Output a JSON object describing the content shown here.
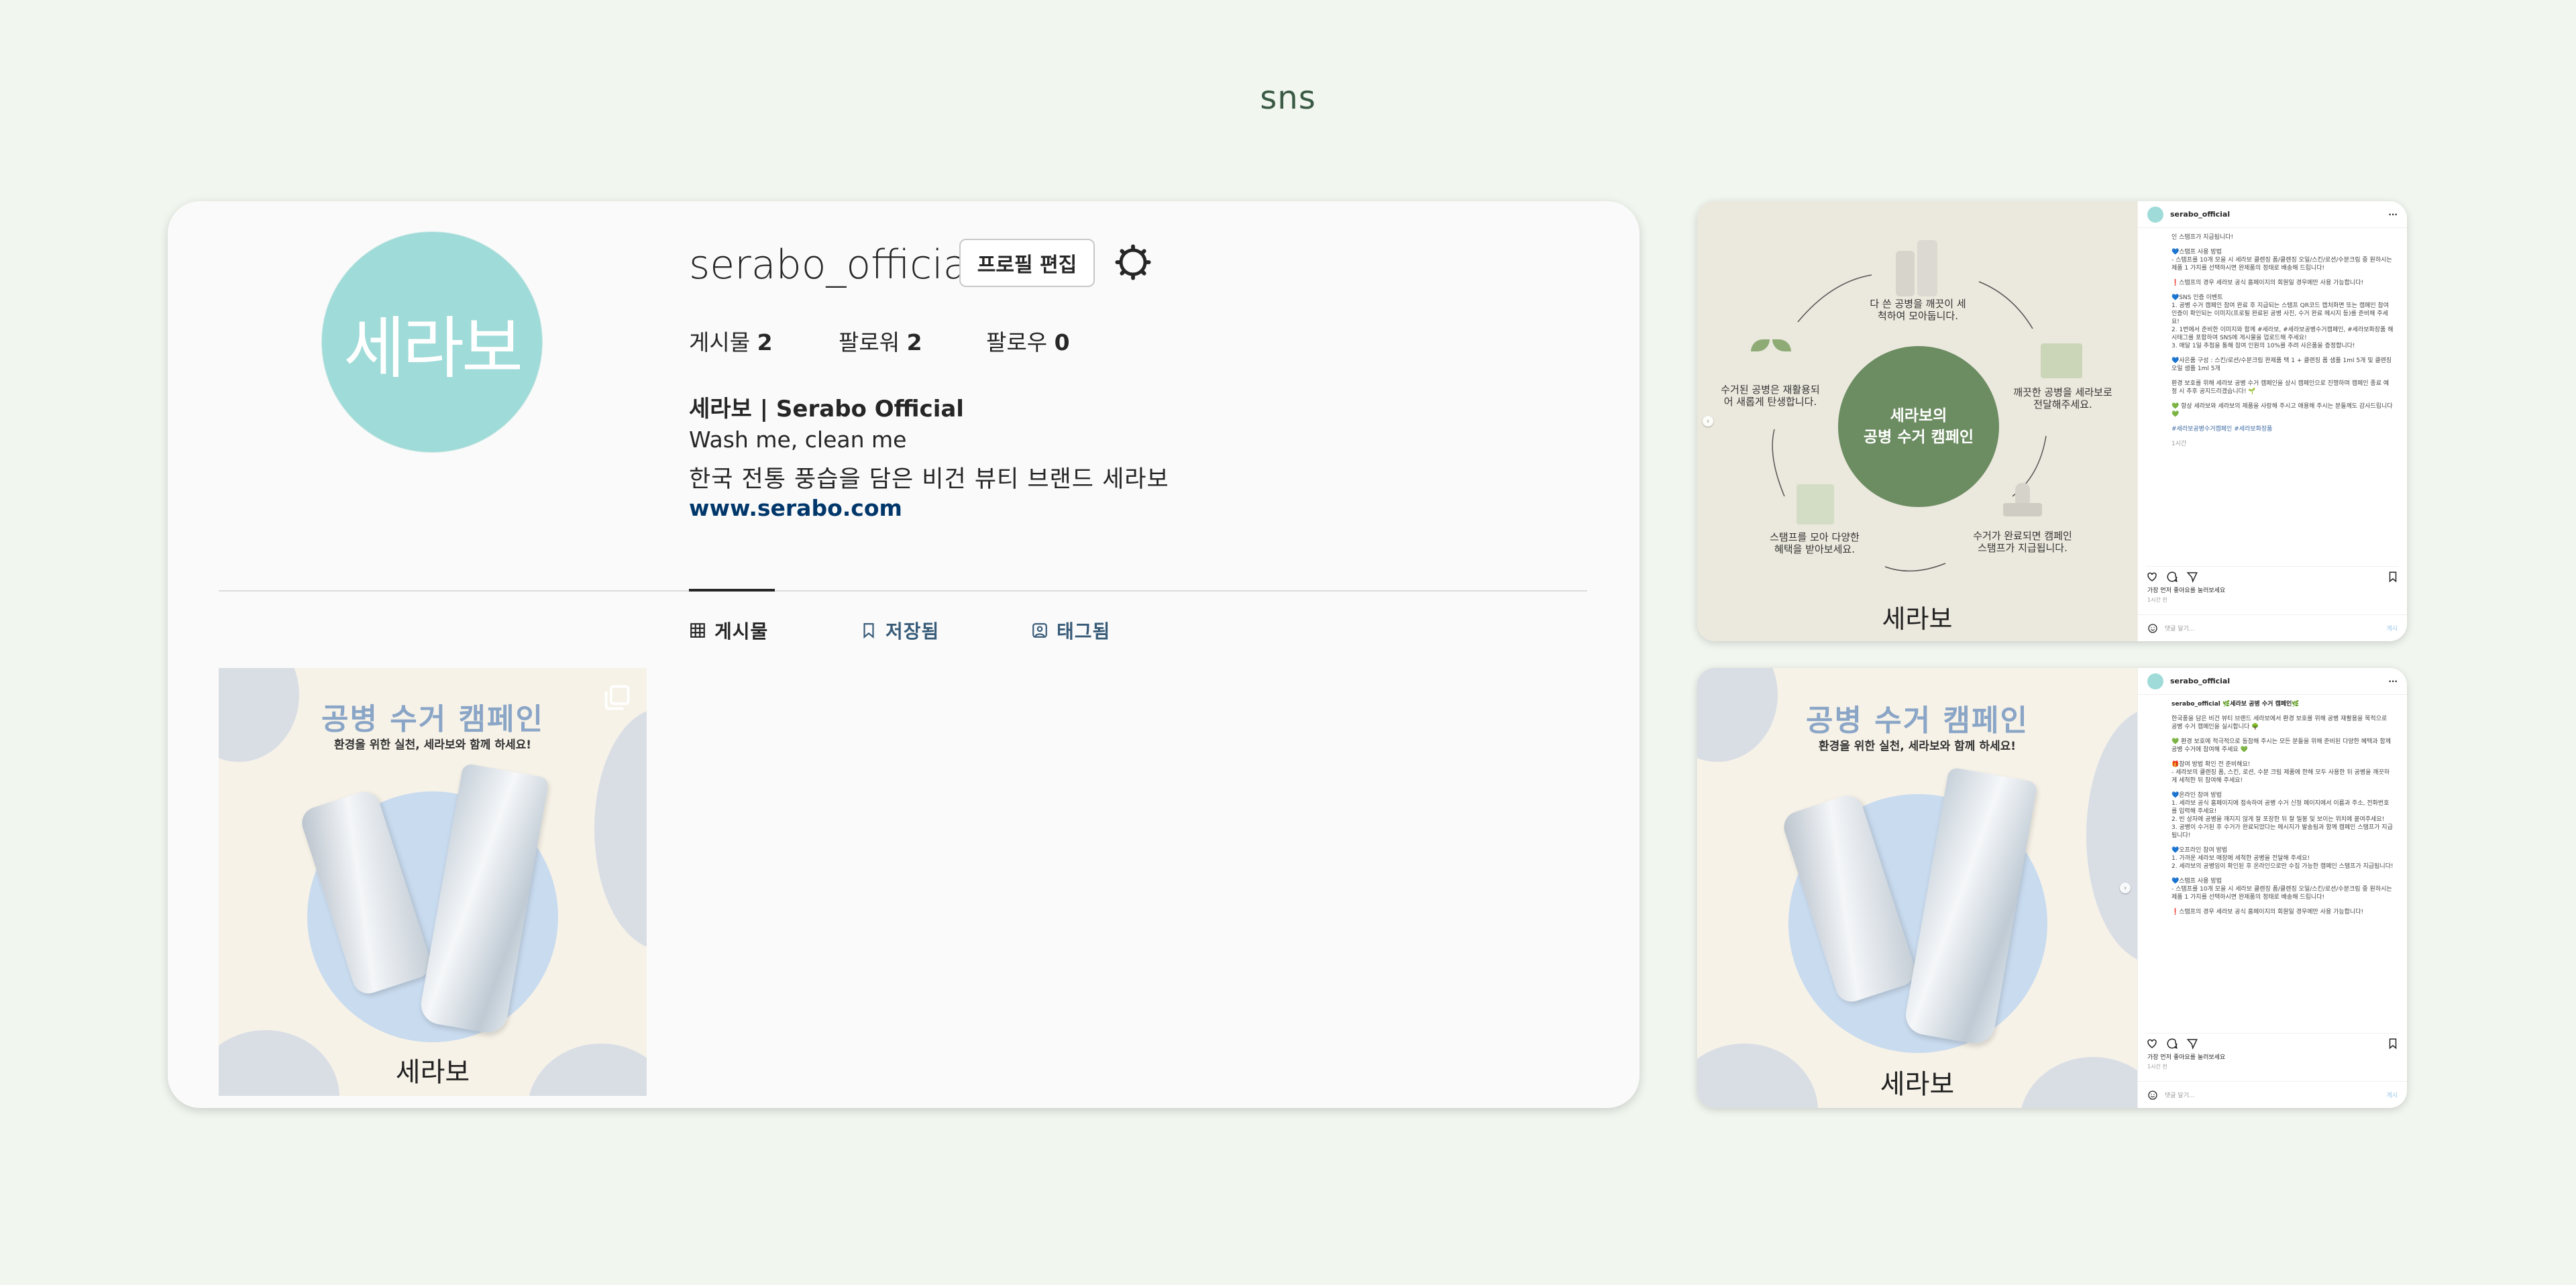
{
  "page": {
    "title": "sns"
  },
  "profile": {
    "username": "serabo_official",
    "edit_button": "프로필 편집",
    "avatar_text": "세라보",
    "stats": [
      {
        "label": "게시물",
        "value": "2"
      },
      {
        "label": "팔로워",
        "value": "2"
      },
      {
        "label": "팔로우",
        "value": "0"
      }
    ],
    "display_name": "세라보 | Serabo Official",
    "bio_line1": "Wash me, clean me",
    "bio_line2": "한국 전통 풍습을 담은 비건 뷰티 브랜드 세라보",
    "website": "www.serabo.com",
    "tabs": [
      {
        "label": "게시물",
        "icon": "grid-icon",
        "active": true
      },
      {
        "label": "저장됨",
        "icon": "bookmark-icon",
        "active": false
      },
      {
        "label": "태그됨",
        "icon": "tag-icon",
        "active": false
      }
    ]
  },
  "poster": {
    "title": "공병 수거 캠페인",
    "subtitle": "환경을 위한 실천, 세라보와 함께 하세요!",
    "logo": "세라보"
  },
  "diagram": {
    "center_line1": "세라보의",
    "center_line2": "공병 수거 캠페인",
    "steps": [
      "다 쓴 공병을 깨끗이 세척하여 모아둡니다.",
      "깨끗한 공병을 세라보로 전달해주세요.",
      "수거가 완료되면 캠페인 스탬프가 지급됩니다.",
      "스탬프를 모아 다양한 혜택을 받아보세요.",
      "수거된 공병은 재활용되어 새롭게 탄생합니다."
    ],
    "logo": "세라보"
  },
  "card1": {
    "account": "serabo_official",
    "more": "···",
    "caption": [
      "인 스탬프가 지급됩니다!",
      "💙스탬프 사용 방법\n- 스탬프를 10개 모을 시 세라보 클렌징 폼/클렌징 오일/스킨/로션/수분크림 중 원하시는 제품 1 가지를 선택하시면 완제품의 정태로 배송해 드립니다!",
      "❗스탬프의 경우 세라보 공식 홈페이지의 회원일 경우에만 사용 가능합니다!",
      "💙SNS 인증 이벤트\n1. 공병 수거 캠페인 참여 완료 후 지급되는 스탬프 QR코드 캡처화면 또는 캠페인 참여 인증이 확인되는 이미지(프로필 완료된 공병 사진, 수거 완료 메시지 등)를 준비해 주세요!\n2. 1번에서 준비한 이미지와 함께 #세라보, #세라보공병수거캠페인, #세라보화장품 해시태그를 포함하여 SNS에 게시물을 업로드해 주세요!\n3. 매달 1일 추첨을 통해 참여 인원의 10%를 추려 사은품을 증정합니다!",
      "💙사은품 구성 : 스킨/로션/수분크림 완제품 택 1 + 클렌징 폼 샘플 1ml 5개 및 클렌징 오일 샘플 1ml 5개",
      "환경 보호를 위해 세라보 공병 수거 캠페인을 상시 캠페인으로 진행하며 캠페인 종료 예정 시 추후 공지드리겠습니다! 🌱",
      "💚 항상 세라보와 세라보의 제품을 사랑해 주시고 애용해 주시는 분들께도 감사드립니다 💚",
      "#세라보공병수거캠페인 #세라보화장품",
      "1시간"
    ],
    "likes": "가장 먼저 좋아요를 눌러보세요",
    "time": "1시간 전",
    "comment_placeholder": "댓글 달기...",
    "post_label": "게시"
  },
  "card2": {
    "account": "serabo_official",
    "more": "···",
    "caption": [
      "serabo_official 🌿세라보 공병 수거 캠페인🌿",
      "한국풍을 담은 비건 뷰티 브랜드 세라보에서 환경 보호를 위해 공병 재활용을 목적으로 공병 수거 캠페인을 실시합니다 🌳",
      "💚 환경 보호에 적극적으로 동참해 주시는 모든 분들을 위해 준비된 다양한 혜택과 함께 공병 수거에 참여해 주세요 💚",
      "🎁참여 방법 확인 전 준비해요!\n- 세라보의 클렌징 폼, 스킨, 로션, 수분 크림 제품에 한해 모두 사용한 뒤 공병을 깨끗하게 세척한 뒤 참여해 주세요!",
      "💙온라인 참여 방법\n1. 세라보 공식 홈페이지에 접속하여 공병 수거 신청 페이지에서 이름과 주소, 전화번호를 입력해 주세요!\n2. 빈 상자에 공병을 깨지지 않게 잘 포장한 뒤 잘 밀봉 및 보이는 위치에 붙여주세요!\n3. 공병이 수거된 후 수거가 완료되었다는 메시지가 발송됨과 함께 캠페인 스탬프가 지급됩니다!",
      "💙오프라인 참여 방법\n1. 가까운 세라보 매장에 세척한 공병을 전달해 주세요!\n2. 세라보의 공병임이 확인된 후 온라인으로만 수집 가능한 캠페인 스탬프가 지급됩니다!",
      "💙스탬프 사용 방법\n- 스탬프를 10개 모을 시 세라보 클렌징 폼/클렌징 오일/스킨/로션/수분크림 중 원하시는 제품 1 가지를 선택하시면 완제품의 정태로 배송해 드립니다!",
      "❗스탬프의 경우 세라보 공식 홈페이지의 회원일 경우에만 사용 가능합니다!"
    ],
    "likes": "가장 먼저 좋아요를 눌러보세요",
    "time": "1시간 전",
    "comment_placeholder": "댓글 달기...",
    "post_label": "게시"
  },
  "colors": {
    "background": "#f1f6ef",
    "avatar": "#9fdbd8",
    "link": "#00376b",
    "campaign_green": "#6c8c62",
    "poster_title": "#8aa5c6"
  }
}
